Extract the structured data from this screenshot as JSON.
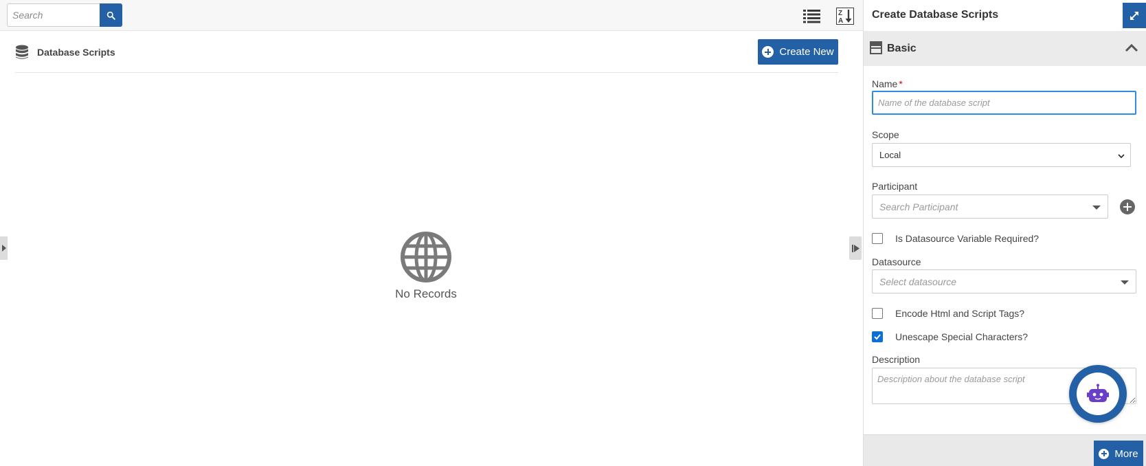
{
  "topbar": {
    "search_placeholder": "Search",
    "icons": [
      "search-icon",
      "list-view-icon",
      "sort-alpha-icon"
    ]
  },
  "main": {
    "title": "Database Scripts",
    "create_label": "Create New",
    "empty_text": "No Records"
  },
  "panel": {
    "title": "Create Database Scripts",
    "section_title": "Basic",
    "fields": {
      "name_label": "Name",
      "name_required": "*",
      "name_placeholder": "Name of the database script",
      "scope_label": "Scope",
      "scope_value": "Local",
      "participant_label": "Participant",
      "participant_placeholder": "Search Participant",
      "datasource_var_label": "Is Datasource Variable Required?",
      "datasource_var_checked": false,
      "datasource_label": "Datasource",
      "datasource_placeholder": "Select datasource",
      "encode_label": "Encode Html and Script Tags?",
      "encode_checked": false,
      "unescape_label": "Unescape Special Characters?",
      "unescape_checked": true,
      "description_label": "Description",
      "description_placeholder": "Description about the database script"
    },
    "more_label": "More"
  },
  "colors": {
    "primary": "#2360a5",
    "focus": "#2f8be0",
    "required": "#d0021b",
    "checkbox": "#0b6fd6",
    "bot": "#6a3fc7"
  }
}
